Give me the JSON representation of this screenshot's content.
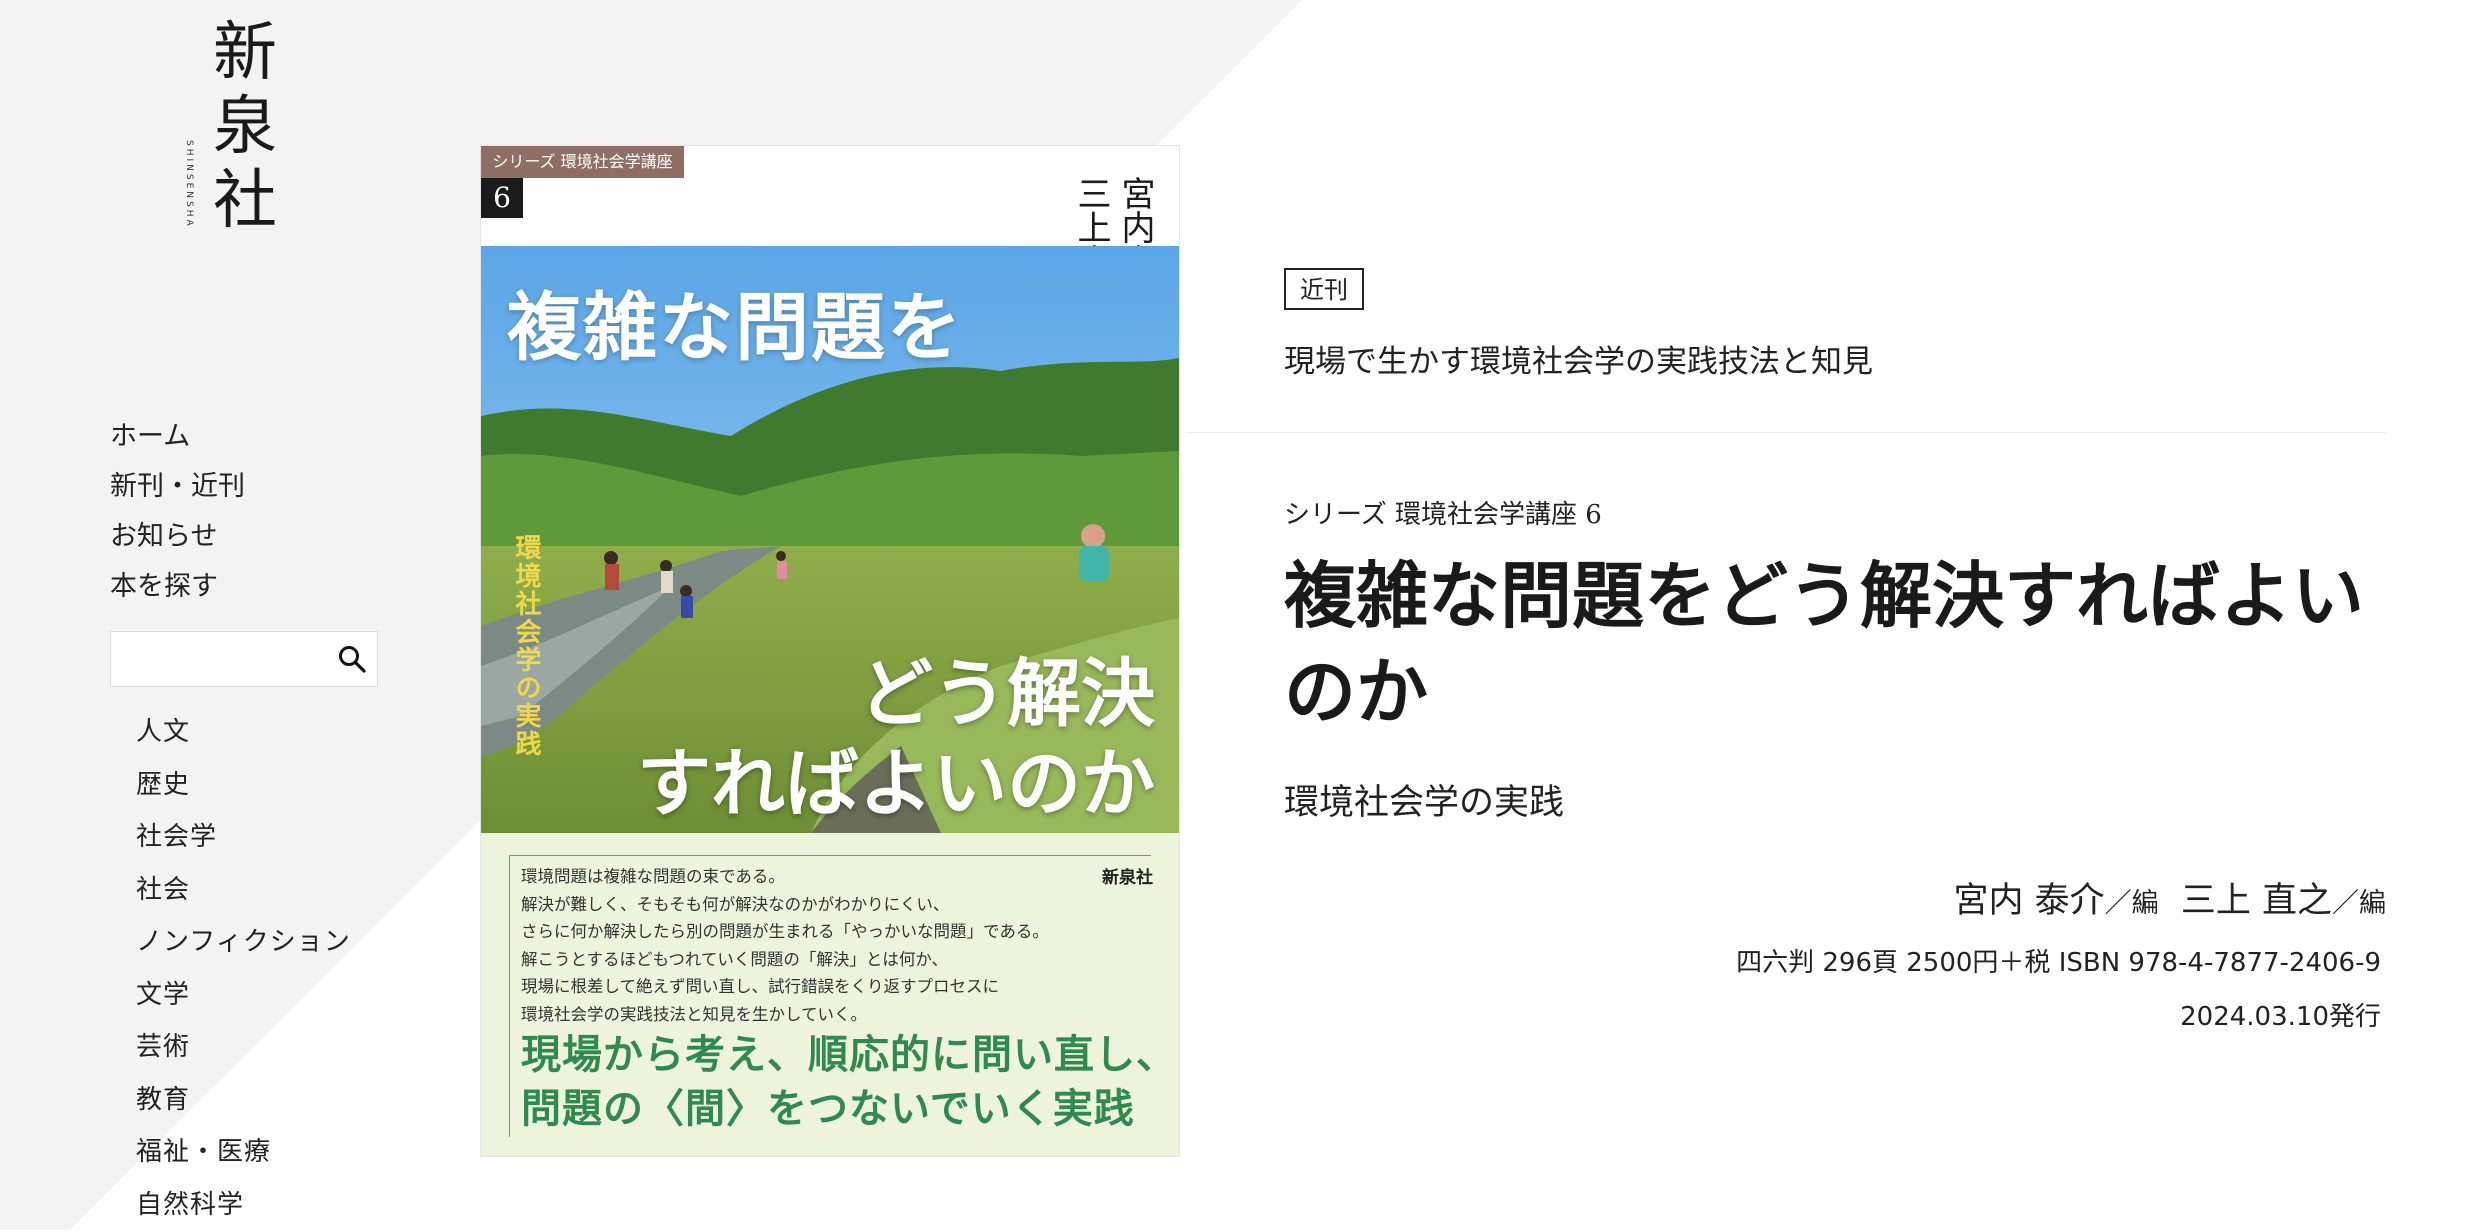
{
  "logo": {
    "line1": "新",
    "line2": "泉",
    "line3": "社",
    "roman": "SHINSENSHA"
  },
  "nav": [
    "ホーム",
    "新刊・近刊",
    "お知らせ",
    "本を探す"
  ],
  "search": {
    "placeholder": ""
  },
  "categories": [
    "人文",
    "歴史",
    "社会学",
    "社会",
    "ノンフィクション",
    "文学",
    "芸術",
    "教育",
    "福祉・医療",
    "自然科学"
  ],
  "cover": {
    "series_tag": "シリーズ 環境社会学講座",
    "series_number": "6",
    "authors": "宮内泰介　三上直之",
    "editor_mark": "編",
    "title_top": "複雑な問題を",
    "title_bottom_1": "どう解決",
    "title_bottom_2": "すればよいのか",
    "vertical_subtitle": "環境社会学の実践",
    "publisher": "新泉社",
    "blurb": [
      "環境問題は複雑な問題の束である。",
      "解決が難しく、そもそも何が解決なのかがわかりにくい、",
      "さらに何か解決したら別の問題が生まれる「やっかいな問題」である。",
      "解こうとするほどもつれていく問題の「解決」とは何か、",
      "現場に根差して絶えず問い直し、試行錯誤をくり返すプロセスに",
      "環境社会学の実践技法と知見を生かしていく。"
    ],
    "catch_1": "現場から考え、順応的に問い直し、",
    "catch_2": "問題の〈間〉をつないでいく実践"
  },
  "info": {
    "badge": "近刊",
    "lead": "現場で生かす環境社会学の実践技法と知見",
    "series": "シリーズ 環境社会学講座 6",
    "title": "複雑な問題をどう解決すればよいのか",
    "subtitle": "環境社会学の実践",
    "author1": "宮内 泰介",
    "role1": "／編",
    "author2": "三上 直之",
    "role2": "／編",
    "specs": "四六判  296頁  2500円＋税  ISBN 978-4-7877-2406-9",
    "date": "2024.03.10発行"
  }
}
